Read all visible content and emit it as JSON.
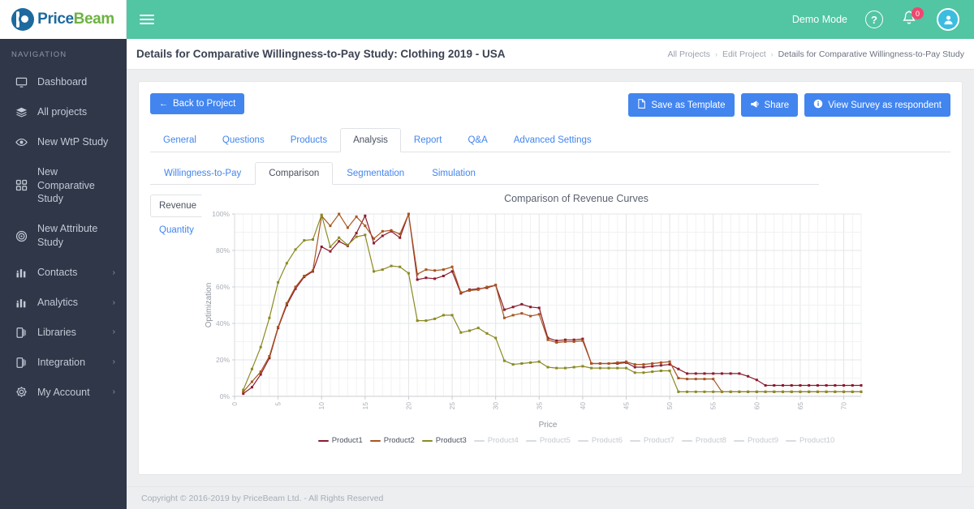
{
  "brand": {
    "logo_text_1": "Price",
    "logo_text_2": "Beam",
    "logo_color_1": "#1d6a9e",
    "logo_color_2": "#6cb33f"
  },
  "topbar": {
    "menu_toggle": "≡",
    "demo_mode": "Demo Mode",
    "help_icon": "?",
    "notification_count": "0",
    "accent_color": "#52c5a3",
    "badge_color": "#ef476f"
  },
  "sidebar": {
    "section_label": "NAVIGATION",
    "background": "#2f3749",
    "items": [
      {
        "label": "Dashboard",
        "icon": "monitor-icon",
        "caret": ""
      },
      {
        "label": "All projects",
        "icon": "layers-icon",
        "caret": ""
      },
      {
        "label": "New WtP Study",
        "icon": "eye-icon",
        "caret": ""
      },
      {
        "label": "New Comparative Study",
        "icon": "grid-icon",
        "caret": ""
      },
      {
        "label": "New Attribute Study",
        "icon": "target-icon",
        "caret": ""
      },
      {
        "label": "Contacts",
        "icon": "bar-chart-icon",
        "caret": "›"
      },
      {
        "label": "Analytics",
        "icon": "bar-chart-icon",
        "caret": "›"
      },
      {
        "label": "Libraries",
        "icon": "book-icon",
        "caret": "›"
      },
      {
        "label": "Integration",
        "icon": "book-icon",
        "caret": "›"
      },
      {
        "label": "My Account",
        "icon": "gear-icon",
        "caret": "›"
      }
    ]
  },
  "page": {
    "title": "Details for Comparative Willingness-to-Pay Study: Clothing 2019 - USA",
    "breadcrumb": [
      {
        "label": "All Projects",
        "active": false
      },
      {
        "label": "Edit Project",
        "active": false
      },
      {
        "label": "Details for Comparative Willingness-to-Pay Study",
        "active": true
      }
    ],
    "breadcrumb_separator": "›"
  },
  "toolbar": {
    "back_label": "Back to Project",
    "back_icon": "←",
    "save_template_label": "Save as Template",
    "save_template_icon": "Ὄ4",
    "share_label": "Share",
    "share_icon": "✉",
    "view_survey_label": "View Survey as respondent",
    "view_survey_icon": "ⓘ",
    "primary_color": "#4285ef"
  },
  "tabs": {
    "main": [
      {
        "label": "General",
        "active": false
      },
      {
        "label": "Questions",
        "active": false
      },
      {
        "label": "Products",
        "active": false
      },
      {
        "label": "Analysis",
        "active": true
      },
      {
        "label": "Report",
        "active": false
      },
      {
        "label": "Q&A",
        "active": false
      },
      {
        "label": "Advanced Settings",
        "active": false
      }
    ],
    "sub": [
      {
        "label": "Willingness-to-Pay",
        "active": false
      },
      {
        "label": "Comparison",
        "active": true
      },
      {
        "label": "Segmentation",
        "active": false
      },
      {
        "label": "Simulation",
        "active": false
      }
    ],
    "vertical": [
      {
        "label": "Revenue",
        "active": true
      },
      {
        "label": "Quantity",
        "active": false
      }
    ]
  },
  "footer": {
    "copyright": "Copyright © 2016-2019 by PriceBeam Ltd. - All Rights Reserved"
  },
  "chart_data": {
    "type": "line",
    "title": "Comparison of Revenue Curves",
    "xlabel": "Price",
    "ylabel": "Optimization",
    "xlim": [
      0,
      72
    ],
    "ylim": [
      0,
      100
    ],
    "xticks": [
      0,
      5,
      10,
      15,
      20,
      25,
      30,
      35,
      40,
      45,
      50,
      55,
      60,
      65,
      70
    ],
    "yticks": [
      0,
      20,
      40,
      60,
      80,
      100
    ],
    "ytick_labels": [
      "0%",
      "20%",
      "40%",
      "60%",
      "80%",
      "100%"
    ],
    "grid": true,
    "legend_position": "bottom",
    "x": [
      1,
      2,
      3,
      4,
      5,
      6,
      7,
      8,
      9,
      10,
      11,
      12,
      13,
      14,
      15,
      16,
      17,
      18,
      19,
      20,
      21,
      22,
      23,
      24,
      25,
      26,
      27,
      28,
      29,
      30,
      31,
      32,
      33,
      34,
      35,
      36,
      37,
      38,
      39,
      40,
      41,
      42,
      43,
      44,
      45,
      46,
      47,
      48,
      49,
      50,
      51,
      52,
      53,
      54,
      55,
      56,
      57,
      58,
      59,
      60,
      61,
      62,
      63,
      64,
      65,
      66,
      67,
      68,
      69,
      70,
      71,
      72
    ],
    "series": [
      {
        "name": "Product1",
        "color": "#8c1b2e",
        "active": true,
        "values": [
          1.5,
          5,
          12,
          21,
          37.5,
          50,
          59,
          65.5,
          68.5,
          82,
          79.5,
          85,
          82.5,
          89.5,
          99,
          84,
          88,
          90.5,
          87,
          100,
          64,
          65,
          64.5,
          66,
          68.5,
          56.5,
          58.5,
          59,
          59.5,
          61,
          47.5,
          49,
          50.5,
          49,
          48.5,
          32,
          30.5,
          31,
          31,
          31.5,
          18,
          18,
          18,
          18,
          18.5,
          16,
          16,
          16.5,
          17,
          17.5,
          15,
          12.5,
          12.5,
          12.5,
          12.5,
          12.5,
          12.5,
          12.5,
          11,
          9,
          6,
          6,
          6,
          6,
          6,
          6,
          6,
          6,
          6,
          6,
          6,
          6
        ]
      },
      {
        "name": "Product2",
        "color": "#a8551f",
        "active": true,
        "values": [
          2.5,
          8,
          13.5,
          22,
          38,
          51,
          60,
          66,
          69,
          99,
          93.5,
          100,
          92.5,
          98.5,
          93.5,
          86.5,
          90.5,
          91,
          89,
          100,
          67,
          69.5,
          69,
          69.5,
          71,
          57,
          58,
          58.5,
          60,
          61,
          43,
          44.5,
          45.5,
          44,
          45,
          31,
          29.5,
          30,
          30,
          30.5,
          18,
          18,
          18,
          18.5,
          19,
          17.5,
          17.5,
          18,
          18.5,
          19,
          10,
          9.5,
          9.5,
          9.5,
          9.5,
          2.5,
          2.5,
          2.5,
          2.5,
          2.5,
          2.5,
          2.5,
          2.5,
          2.5,
          2.5,
          2.5,
          2.5,
          2.5,
          2.5,
          2.5,
          2.5,
          2.5
        ]
      },
      {
        "name": "Product3",
        "color": "#8a8a22",
        "active": true,
        "values": [
          3.5,
          15,
          27,
          43,
          62.5,
          73,
          80.5,
          85.5,
          86,
          99.5,
          82,
          87,
          83,
          87.5,
          88.5,
          68.5,
          69.5,
          71.5,
          71,
          67.5,
          41.5,
          41.5,
          42.5,
          44.5,
          44.5,
          35,
          36,
          37.5,
          34.5,
          32,
          19.5,
          17.5,
          18,
          18.5,
          19,
          16,
          15.5,
          15.5,
          16,
          16.5,
          15.5,
          15.5,
          15.5,
          15.5,
          15.5,
          13,
          13,
          13.5,
          14,
          14,
          2.5,
          2.5,
          2.5,
          2.5,
          2.5,
          2.5,
          2.5,
          2.5,
          2.5,
          2.5,
          2.5,
          2.5,
          2.5,
          2.5,
          2.5,
          2.5,
          2.5,
          2.5,
          2.5,
          2.5,
          2.5,
          2.5
        ]
      },
      {
        "name": "Product4",
        "color": "#d9dce0",
        "active": false,
        "values": []
      },
      {
        "name": "Product5",
        "color": "#d9dce0",
        "active": false,
        "values": []
      },
      {
        "name": "Product6",
        "color": "#d9dce0",
        "active": false,
        "values": []
      },
      {
        "name": "Product7",
        "color": "#d9dce0",
        "active": false,
        "values": []
      },
      {
        "name": "Product8",
        "color": "#d9dce0",
        "active": false,
        "values": []
      },
      {
        "name": "Product9",
        "color": "#d9dce0",
        "active": false,
        "values": []
      },
      {
        "name": "Product10",
        "color": "#d9dce0",
        "active": false,
        "values": []
      }
    ]
  }
}
